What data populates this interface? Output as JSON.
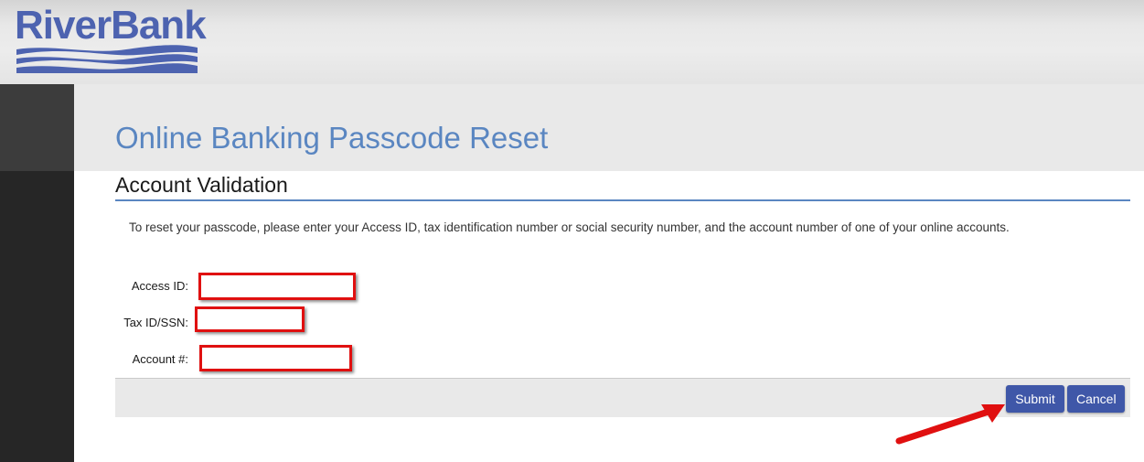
{
  "brand": {
    "logo_text": "RiverBank",
    "primary_color": "#4d63b0",
    "title_color": "#5a86c1"
  },
  "page": {
    "title": "Online Banking Passcode Reset"
  },
  "section": {
    "title": "Account Validation",
    "instructions": "To reset your passcode, please enter your Access ID, tax identification number or social security number, and the account number of one of your online accounts."
  },
  "form": {
    "fields": [
      {
        "label": "Access ID:",
        "value": ""
      },
      {
        "label": "Tax ID/SSN:",
        "value": ""
      },
      {
        "label": "Account #:",
        "value": ""
      }
    ]
  },
  "actions": {
    "submit_label": "Submit",
    "cancel_label": "Cancel"
  },
  "annotations": {
    "highlight_color": "#e01010",
    "arrow_icon": "red-arrow-pointing-to-submit"
  }
}
